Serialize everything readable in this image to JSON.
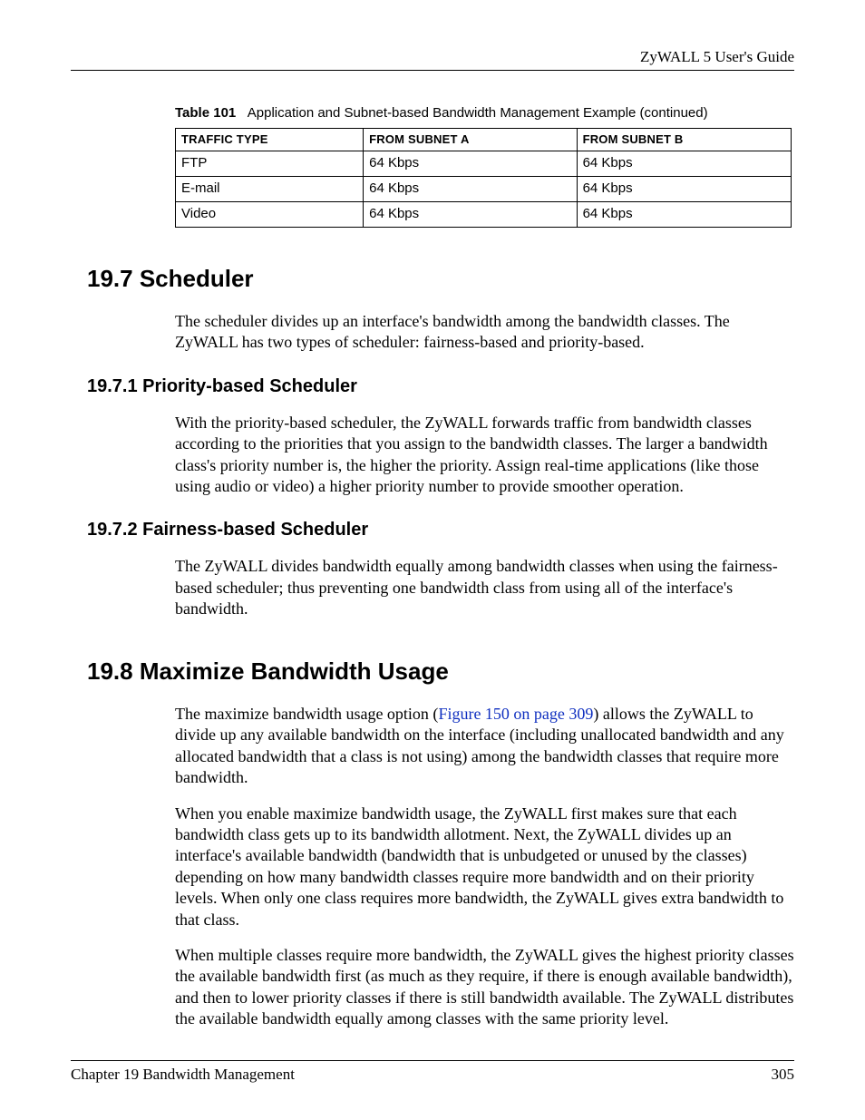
{
  "header": {
    "guide_title": "ZyWALL 5 User's Guide"
  },
  "table101": {
    "caption_label": "Table 101",
    "caption_text": "Application and Subnet-based Bandwidth Management Example  (continued)",
    "headers": {
      "col1": "TRAFFIC TYPE",
      "col2": "FROM SUBNET A",
      "col3": "FROM SUBNET B"
    },
    "rows": [
      {
        "type": "FTP",
        "a": "64 Kbps",
        "b": "64 Kbps"
      },
      {
        "type": "E-mail",
        "a": "64 Kbps",
        "b": "64 Kbps"
      },
      {
        "type": "Video",
        "a": "64 Kbps",
        "b": "64 Kbps"
      }
    ]
  },
  "sections": {
    "s19_7": {
      "heading": "19.7  Scheduler",
      "p1": "The scheduler divides up an interface's bandwidth among the bandwidth classes. The ZyWALL has two types of scheduler: fairness-based and priority-based."
    },
    "s19_7_1": {
      "heading": "19.7.1  Priority-based Scheduler",
      "p1": "With the priority-based scheduler, the ZyWALL forwards traffic from bandwidth classes according to the priorities that you assign to the bandwidth classes. The larger a bandwidth class's priority number is, the higher the priority. Assign real-time applications (like those using audio or video) a higher priority number to provide smoother operation."
    },
    "s19_7_2": {
      "heading": "19.7.2  Fairness-based Scheduler",
      "p1": "The ZyWALL divides bandwidth equally among bandwidth classes when using the fairness-based scheduler; thus preventing one bandwidth class from using all of the interface's bandwidth."
    },
    "s19_8": {
      "heading": "19.8  Maximize Bandwidth Usage",
      "p1_pre": "The maximize bandwidth usage option (",
      "p1_link": "Figure 150 on page 309",
      "p1_post": ") allows the ZyWALL to divide up any available bandwidth on the interface (including unallocated bandwidth and any allocated bandwidth that a class is not using) among the bandwidth classes that require more bandwidth.",
      "p2": "When you enable maximize bandwidth usage, the ZyWALL first makes sure that each bandwidth class gets up to its bandwidth allotment. Next, the ZyWALL divides up an interface's available bandwidth (bandwidth that is unbudgeted or unused by the classes) depending on how many bandwidth classes require more bandwidth and on their priority levels. When only one class requires more bandwidth, the ZyWALL gives extra bandwidth to that class.",
      "p3": "When multiple classes require more bandwidth, the ZyWALL gives the highest priority classes the available bandwidth first (as much as they require, if there is enough available bandwidth), and then to lower priority classes if there is still bandwidth available. The ZyWALL distributes the available bandwidth equally among classes with the same priority level."
    }
  },
  "footer": {
    "chapter": "Chapter 19 Bandwidth Management",
    "page": "305"
  }
}
